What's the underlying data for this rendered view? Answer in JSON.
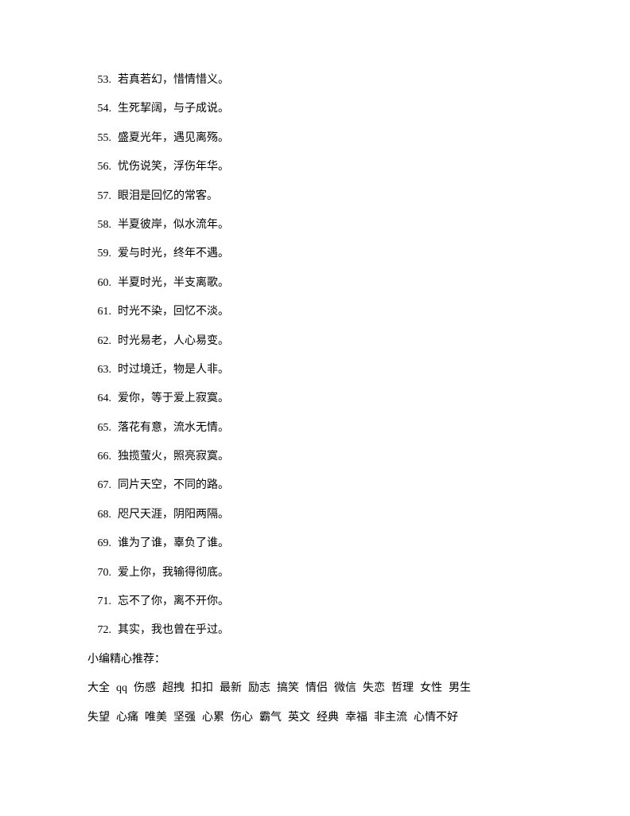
{
  "items": [
    {
      "num": "53.",
      "text": "若真若幻，惜情惜义。"
    },
    {
      "num": "54.",
      "text": "生死挈阔，与子成说。"
    },
    {
      "num": "55.",
      "text": "盛夏光年，遇见离殇。"
    },
    {
      "num": "56.",
      "text": "忧伤说笑，浮伤年华。"
    },
    {
      "num": "57.",
      "text": "眼泪是回忆的常客。"
    },
    {
      "num": "58.",
      "text": "半夏彼岸，似水流年。"
    },
    {
      "num": "59.",
      "text": "爱与时光，终年不遇。"
    },
    {
      "num": "60.",
      "text": "半夏时光，半支离歌。"
    },
    {
      "num": "61.",
      "text": "时光不染，回忆不淡。"
    },
    {
      "num": "62.",
      "text": "时光易老，人心易变。"
    },
    {
      "num": "63.",
      "text": "时过境迁，物是人非。"
    },
    {
      "num": "64.",
      "text": "爱你，等于爱上寂寞。"
    },
    {
      "num": "65.",
      "text": "落花有意，流水无情。"
    },
    {
      "num": "66.",
      "text": "独揽萤火，照亮寂寞。"
    },
    {
      "num": "67.",
      "text": "同片天空，不同的路。"
    },
    {
      "num": "68.",
      "text": "咫尺天涯，阴阳两隔。"
    },
    {
      "num": "69.",
      "text": "谁为了谁，辜负了谁。"
    },
    {
      "num": "70.",
      "text": "爱上你，我输得彻底。"
    },
    {
      "num": "71.",
      "text": "忘不了你，离不开你。"
    },
    {
      "num": "72.",
      "text": "其实，我也曾在乎过。"
    }
  ],
  "recommend_title": "小编精心推荐：",
  "tags_row1": [
    "大全",
    "qq",
    "伤感",
    "超拽",
    "扣扣",
    "最新",
    "励志",
    "搞笑",
    "情侣",
    "微信",
    "失恋",
    "哲理",
    "女性",
    "男生"
  ],
  "tags_row2": [
    "失望",
    "心痛",
    "唯美",
    "坚强",
    "心累",
    "伤心",
    "霸气",
    "英文",
    "经典",
    "幸福",
    "非主流",
    "心情不好"
  ]
}
